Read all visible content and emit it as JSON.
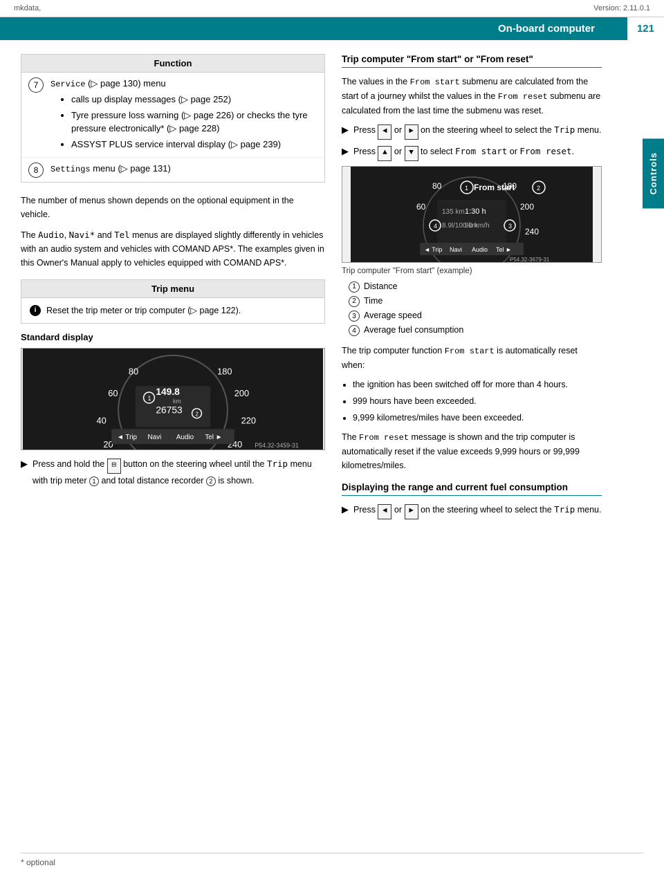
{
  "topbar": {
    "left": "mkdata,",
    "right": "Version: 2.11.0.1"
  },
  "header": {
    "title": "On-board computer",
    "page_number": "121"
  },
  "side_label": "Controls",
  "function_table": {
    "title": "Function",
    "rows": [
      {
        "icon": "7",
        "text_code": "Service",
        "text_suffix": " (▷ page 130) menu",
        "bullets": [
          "calls up display messages (▷ page 252)",
          "Tyre pressure loss warning (▷ page 226) or checks the tyre pressure electronically* (▷ page 228)",
          "ASSYST PLUS service interval display (▷ page 239)"
        ]
      },
      {
        "icon": "8",
        "text_code": "Settings",
        "text_suffix": " menu (▷ page 131)"
      }
    ]
  },
  "optional_text": "The number of menus shown depends on the optional equipment in the vehicle.",
  "comand_text": "The Audio, Navi* and Tel menus are displayed slightly differently in vehicles with an audio system and vehicles with COMAND APS*. The examples given in this Owner's Manual apply to vehicles equipped with COMAND APS*.",
  "trip_menu": {
    "title": "Trip menu",
    "content": "Reset the trip meter or trip computer (▷ page 122)."
  },
  "standard_display": {
    "heading": "Standard display",
    "dashboard_caption": "P54.32-3459-31",
    "values": {
      "speed_left": "80",
      "speed_right": "180",
      "speed_200": "200",
      "speed_220": "220",
      "speed_240": "240",
      "speed_60": "60",
      "speed_40": "40",
      "speed_20": "20",
      "odometer": "149.8",
      "odometer_unit": "km",
      "total_dist": "26753",
      "label_trip": "◄ Trip",
      "label_navi": "Navi",
      "label_audio": "Audio",
      "label_tel": "Tel ►"
    },
    "num_labels": [
      "1",
      "2"
    ],
    "press_instruction": "Press and hold the",
    "press_key": "⊟",
    "press_rest": "button on the steering wheel until the Trip menu with trip meter",
    "circle_1": "1",
    "press_rest2": "and total distance recorder",
    "circle_2": "2",
    "press_rest3": "is shown."
  },
  "right_column": {
    "trip_from_start_heading": "Trip computer \"From start\" or \"From reset\"",
    "trip_from_start_text": "The values in the From start submenu are calculated from the start of a journey whilst the values in the From reset submenu are calculated from the last time the submenu was reset.",
    "press_row1a": "Press",
    "press_row1_key1": "◄",
    "press_row1_or": "or",
    "press_row1_key2": "►",
    "press_row1b": "on the steering wheel to select the Trip menu.",
    "press_row2a": "Press",
    "press_row2_key1": "▲",
    "press_row2_or": "or",
    "press_row2_key2": "▼",
    "press_row2b_pre": "to select",
    "press_row2b_code": "From start",
    "press_row2b_or": "or",
    "press_row2b_code2": "From reset",
    "press_row2b_end": ".",
    "dashboard_right_caption": "Trip computer \"From start\" (example)",
    "dashboard_right_ref": "P54.32-3679-31",
    "numbered_items": [
      {
        "num": "1",
        "label": "Distance"
      },
      {
        "num": "2",
        "label": "Time"
      },
      {
        "num": "3",
        "label": "Average speed"
      },
      {
        "num": "4",
        "label": "Average fuel consumption"
      }
    ],
    "from_start_auto_text": "The trip computer function From start is automatically reset when:",
    "bullet_items": [
      "the ignition has been switched off for more than 4 hours.",
      "999 hours have been exceeded.",
      "9,999 kilometres/miles have been exceeded."
    ],
    "from_reset_text": "The From reset message is shown and the trip computer is automatically reset if the value exceeds 9,999 hours or 99,999 kilometres/miles.",
    "fuel_heading": "Displaying the range and current fuel consumption",
    "fuel_press_a": "Press",
    "fuel_press_key1": "◄",
    "fuel_press_or": "or",
    "fuel_press_key2": "►",
    "fuel_press_b": "on the steering wheel to select the Trip menu."
  },
  "footer": {
    "left": "* optional"
  }
}
